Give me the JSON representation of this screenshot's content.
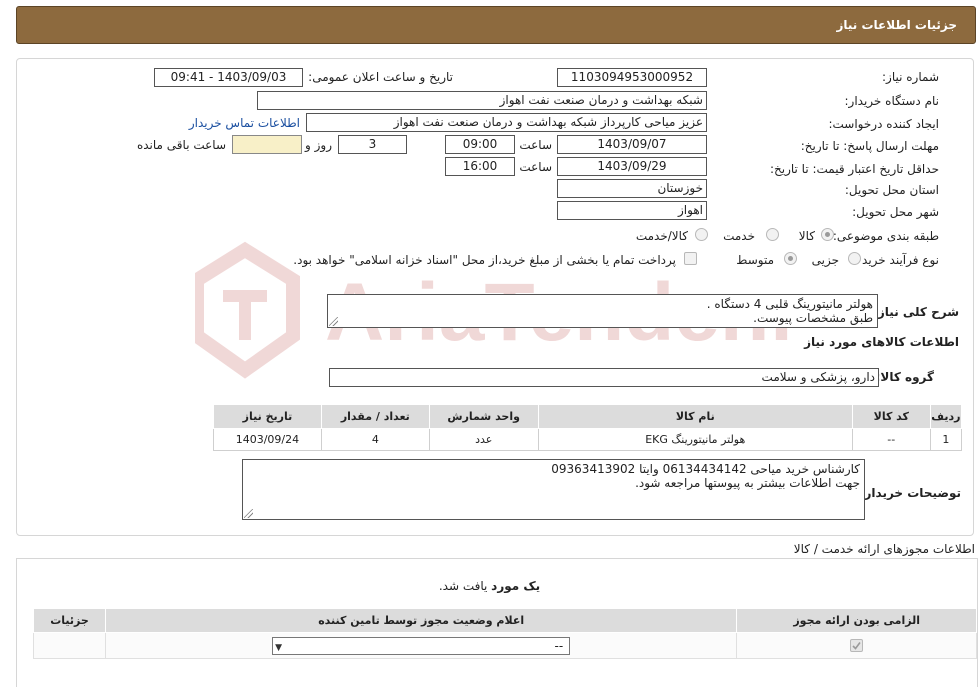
{
  "header": {
    "title": "جزئیات اطلاعات نیاز"
  },
  "fields": {
    "need_number_label": "شماره نیاز:",
    "need_number": "1103094953000952",
    "announce_label": "تاریخ و ساعت اعلان عمومی:",
    "announce_value": "1403/09/03 - 09:41",
    "buyer_org_label": "نام دستگاه خریدار:",
    "buyer_org": "شبکه بهداشت و درمان صنعت نفت اهواز",
    "creator_label": "ایجاد کننده درخواست:",
    "creator": "عزیز میاحی کارپرداز شبکه بهداشت و درمان صنعت نفت اهواز",
    "contact_link": "اطلاعات تماس خریدار",
    "reply_deadline_label": "مهلت ارسال پاسخ: تا تاریخ:",
    "reply_date": "1403/09/07",
    "time_label": "ساعت",
    "reply_time": "09:00",
    "days_value": "3",
    "days_label": "روز و",
    "remaining_value": "",
    "remaining_label": "ساعت باقی مانده",
    "price_validity_label": "حداقل تاریخ اعتبار قیمت: تا تاریخ:",
    "price_date": "1403/09/29",
    "price_time": "16:00",
    "province_label": "استان محل تحویل:",
    "province": "خوزستان",
    "city_label": "شهر محل تحویل:",
    "city": "اهواز",
    "category_label": "طبقه بندی موضوعی:",
    "category_options": [
      "کالا",
      "خدمت",
      "کالا/خدمت"
    ],
    "process_label": "نوع فرآیند خرید :",
    "process_options": [
      "جزیی",
      "متوسط"
    ],
    "payment_note": "پرداخت تمام یا بخشی از مبلغ خرید،از محل \"اسناد خزانه اسلامی\" خواهد بود."
  },
  "description": {
    "label": "شرح کلی نیاز:",
    "line1": "هولتر مانیتورینگ قلبی 4 دستگاه .",
    "line2": "طبق مشخصات پیوست."
  },
  "goods": {
    "section_title": "اطلاعات کالاهای مورد نیاز",
    "group_label": "گروه کالا:",
    "group_value": "دارو، پزشکی و سلامت",
    "columns": [
      "ردیف",
      "کد کالا",
      "نام کالا",
      "واحد شمارش",
      "تعداد / مقدار",
      "تاریخ نیاز"
    ],
    "rows": [
      {
        "row": "1",
        "code": "--",
        "name": "هولتر مانیتورینگ EKG",
        "unit": "عدد",
        "qty": "4",
        "date": "1403/09/24"
      }
    ]
  },
  "buyer_notes": {
    "label": "توضیحات خریدار:",
    "line1": "کارشناس خرید میاحی 06134434142 وایتا 09363413902",
    "line2": "جهت اطلاعات بیشتر به پیوستها مراجعه شود."
  },
  "licenses": {
    "title": "اطلاعات مجوزهای ارائه خدمت / کالا",
    "found_bold": "یک مورد",
    "found_rest": " یافت شد.",
    "columns": [
      "الزامی بودن ارائه مجوز",
      "اعلام وضعیت مجوز توسط تامین کننده",
      "جزئیات"
    ],
    "select_value": "--"
  },
  "watermark": {
    "text": "AriaTender.neT"
  },
  "colors": {
    "header_bg": "#8d6a3e",
    "link": "#1b4fa0",
    "table_header": "#dcdcdc",
    "watermark": "#c0504d"
  }
}
